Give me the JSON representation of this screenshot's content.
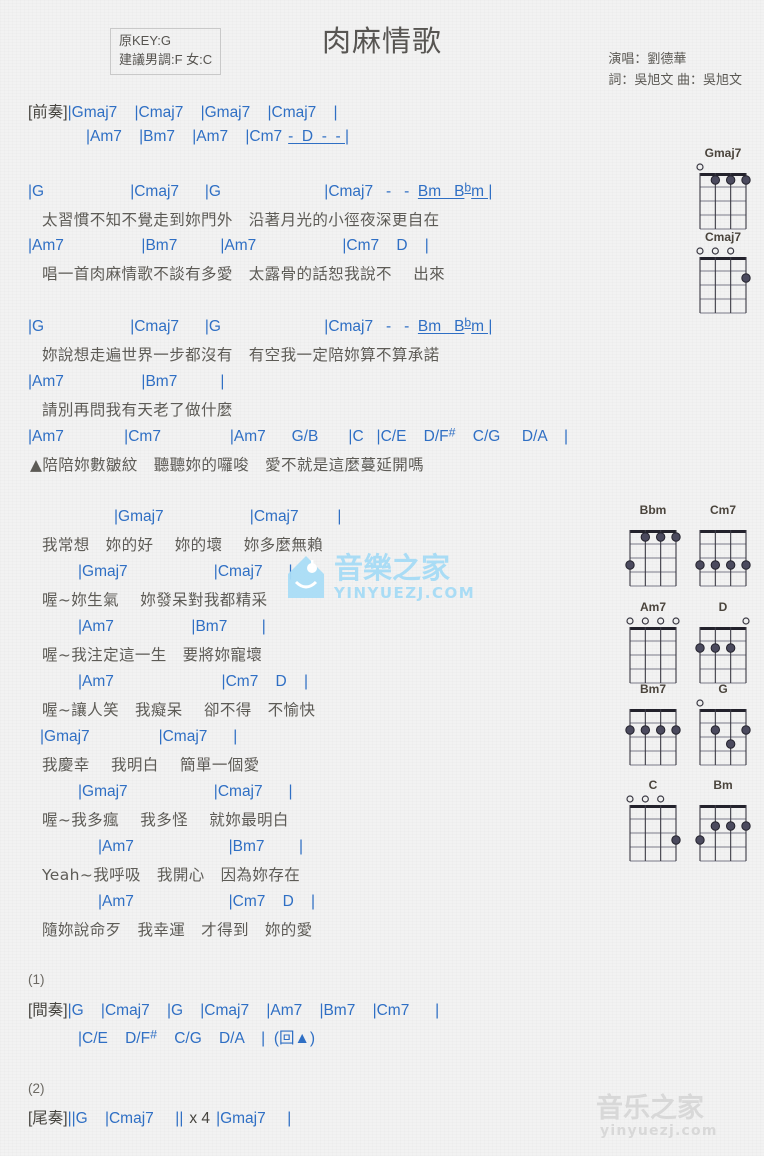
{
  "header": {
    "title": "肉麻情歌",
    "key_original": "原KEY:G",
    "key_suggested": "建議男調:F 女:C",
    "singer": "演唱：劉德華",
    "writers": "詞：吳旭文  曲：吳旭文"
  },
  "colors": {
    "chord": "#2f6fc4",
    "lyric": "#5d5b56",
    "bar": "#6a6155",
    "background": "#f2f2f2",
    "watermark": "#a9dcf5"
  },
  "sections": {
    "intro_tag": "[前奏]",
    "interlude_tag": "[間奏]",
    "outro_tag": "[尾奏]",
    "repeat_1": "(1)",
    "repeat_2": "(2)",
    "interlude_return": "(回▲)",
    "outro_times": "x 4"
  },
  "lines": {
    "intro_1": "|Gmaj7    |Cmaj7    |Gmaj7    |Cmaj7    |",
    "intro_2": "|Am7    |Bm7    |Am7    |Cm7",
    "intro_2_tail": "-  D  -  - |",
    "v1_c1_a": "|G                    |Cmaj7      |G                        |Cmaj7   -   -  ",
    "v1_c1_b": "Bm   B",
    "v1_c1_c": "m |",
    "v1_l1": "太習慣不知不覺走到妳門外   沿著月光的小徑夜深更自在",
    "v1_c2": "|Am7                  |Bm7          |Am7                    |Cm7    D    |",
    "v1_l2": "唱一首肉麻情歌不談有多愛   太露骨的話恕我說不    出來",
    "v2_c1_a": "|G                    |Cmaj7      |G                        |Cmaj7   -   -  ",
    "v2_c1_b": "Bm   B",
    "v2_c1_c": "m |",
    "v2_l1": "妳說想走遍世界一步都沒有   有空我一定陪妳算不算承諾",
    "v2_c2": "|Am7                  |Bm7          |",
    "v2_l2": "請別再問我有天老了做什麼",
    "v2_c3_a": "|Am7              |Cm7                |Am7      G/B       |C   |C/E    D/F",
    "v2_c3_b": "    C/G     D/A    |",
    "v2_l3": "▲陪陪妳數皺紋   聽聽妳的囉唆   愛不就是這麼蔓延開嗎",
    "ch_c1": "|Gmaj7                    |Cmaj7         |",
    "ch_l1": "我常想   妳的好    妳的壞    妳多麼無賴",
    "ch_c2": "|Gmaj7                    |Cmaj7      |",
    "ch_l2": "喔~妳生氣    妳發呆對我都精采",
    "ch_c3": "|Am7                  |Bm7        |",
    "ch_l3": "喔~我注定這一生   要將妳寵壞",
    "ch_c4": "|Am7                         |Cm7    D    |",
    "ch_l4": "喔~讓人笑   我癡呆    卻不得   不愉快",
    "ch_c5": "|Gmaj7                |Cmaj7      |",
    "ch_l5": "我慶幸    我明白    簡單一個愛",
    "ch_c6": "|Gmaj7                    |Cmaj7      |",
    "ch_l6": "喔~我多瘋    我多怪    就妳最明白",
    "ch_c7": "|Am7                      |Bm7        |",
    "ch_l7": "Yeah~我呼吸   我開心   因為妳存在",
    "ch_c8": "|Am7                      |Cm7    D    |",
    "ch_l8": "隨妳說命歹   我幸運   才得到   妳的愛",
    "interlude_1": "|G    |Cmaj7    |G    |Cmaj7    |Am7    |Bm7    |Cm7      |",
    "interlude_2_a": "|C/E    D/F",
    "interlude_2_b": "    C/G    D/A    |  (回▲)",
    "outro_a": "||G    |Cmaj7     ||",
    "outro_b": "|Gmaj7     |"
  },
  "chord_diagrams": [
    {
      "name": "Gmaj7",
      "open": [
        true,
        false,
        false,
        false
      ],
      "dots": [
        {
          "s": 2,
          "f": 1
        },
        {
          "s": 3,
          "f": 1
        },
        {
          "s": 4,
          "f": 1
        }
      ]
    },
    {
      "name": "Cmaj7",
      "open": [
        true,
        true,
        true,
        false
      ],
      "dots": [
        {
          "s": 4,
          "f": 2
        }
      ]
    },
    {
      "name": "Bbm",
      "open": [
        false,
        false,
        false,
        false
      ],
      "dots": [
        {
          "s": 2,
          "f": 1
        },
        {
          "s": 3,
          "f": 1
        },
        {
          "s": 4,
          "f": 1
        },
        {
          "s": 1,
          "f": 3
        }
      ]
    },
    {
      "name": "Cm7",
      "open": [
        false,
        false,
        false,
        false
      ],
      "dots": [
        {
          "s": 1,
          "f": 3
        },
        {
          "s": 2,
          "f": 3
        },
        {
          "s": 3,
          "f": 3
        },
        {
          "s": 4,
          "f": 3
        }
      ]
    },
    {
      "name": "Am7",
      "open": [
        true,
        true,
        true,
        true
      ],
      "dots": []
    },
    {
      "name": "D",
      "open": [
        false,
        false,
        false,
        true
      ],
      "dots": [
        {
          "s": 1,
          "f": 2
        },
        {
          "s": 2,
          "f": 2
        },
        {
          "s": 3,
          "f": 2
        }
      ]
    },
    {
      "name": "Bm7",
      "open": [
        false,
        false,
        false,
        false
      ],
      "dots": [
        {
          "s": 1,
          "f": 2
        },
        {
          "s": 2,
          "f": 2
        },
        {
          "s": 3,
          "f": 2
        },
        {
          "s": 4,
          "f": 2
        }
      ]
    },
    {
      "name": "G",
      "open": [
        true,
        false,
        false,
        false
      ],
      "dots": [
        {
          "s": 2,
          "f": 2
        },
        {
          "s": 4,
          "f": 2
        },
        {
          "s": 3,
          "f": 3
        }
      ]
    },
    {
      "name": "C",
      "open": [
        true,
        true,
        true,
        false
      ],
      "dots": [
        {
          "s": 4,
          "f": 3
        }
      ]
    },
    {
      "name": "Bm",
      "open": [
        false,
        false,
        false,
        false
      ],
      "dots": [
        {
          "s": 2,
          "f": 2
        },
        {
          "s": 3,
          "f": 2
        },
        {
          "s": 4,
          "f": 2
        },
        {
          "s": 1,
          "f": 3
        }
      ]
    }
  ],
  "watermark": {
    "brand": "音樂之家",
    "url": "YINYUEZJ.COM",
    "url_bottom": "yinyuezj.com"
  }
}
